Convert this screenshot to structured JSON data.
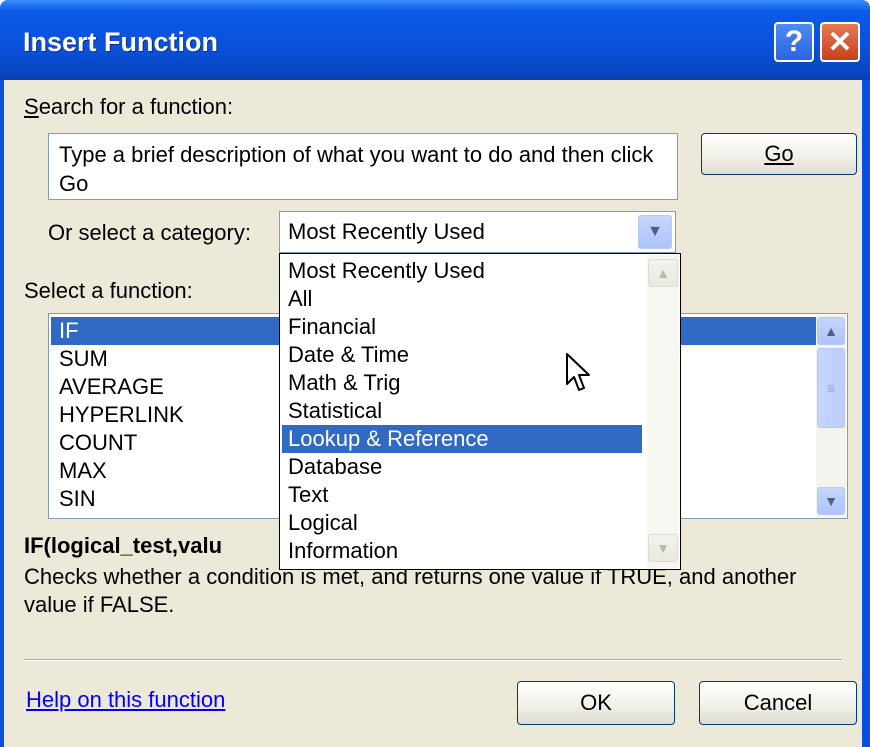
{
  "window": {
    "title": "Insert Function",
    "help_button": "?",
    "close_button": "✕"
  },
  "search": {
    "label": "Search for a function:",
    "value": "Type a brief description of what you want to do and then click Go",
    "go_label": "Go"
  },
  "category": {
    "label": "Or select a category:",
    "selected": "Most Recently Used",
    "options": [
      "Most Recently Used",
      "All",
      "Financial",
      "Date & Time",
      "Math & Trig",
      "Statistical",
      "Lookup & Reference",
      "Database",
      "Text",
      "Logical",
      "Information"
    ],
    "highlighted": "Lookup & Reference"
  },
  "functions": {
    "label": "Select a function:",
    "items": [
      "IF",
      "SUM",
      "AVERAGE",
      "HYPERLINK",
      "COUNT",
      "MAX",
      "SIN"
    ],
    "selected": "IF"
  },
  "details": {
    "signature": "IF(logical_test,valu",
    "description": "Checks whether a condition is met, and returns one value if TRUE, and another value if FALSE."
  },
  "footer": {
    "help_link": "Help on this function",
    "ok_label": "OK",
    "cancel_label": "Cancel"
  },
  "icons": {
    "dropdown_arrow": "chevron-down-icon",
    "scroll_up": "chevron-up-icon",
    "scroll_down": "chevron-down-icon",
    "cursor": "mouse-pointer-icon"
  },
  "colors": {
    "title_bar": "#0a52dc",
    "dialog_bg": "#ece9d8",
    "selection": "#316ac5",
    "link": "#0000ff"
  }
}
